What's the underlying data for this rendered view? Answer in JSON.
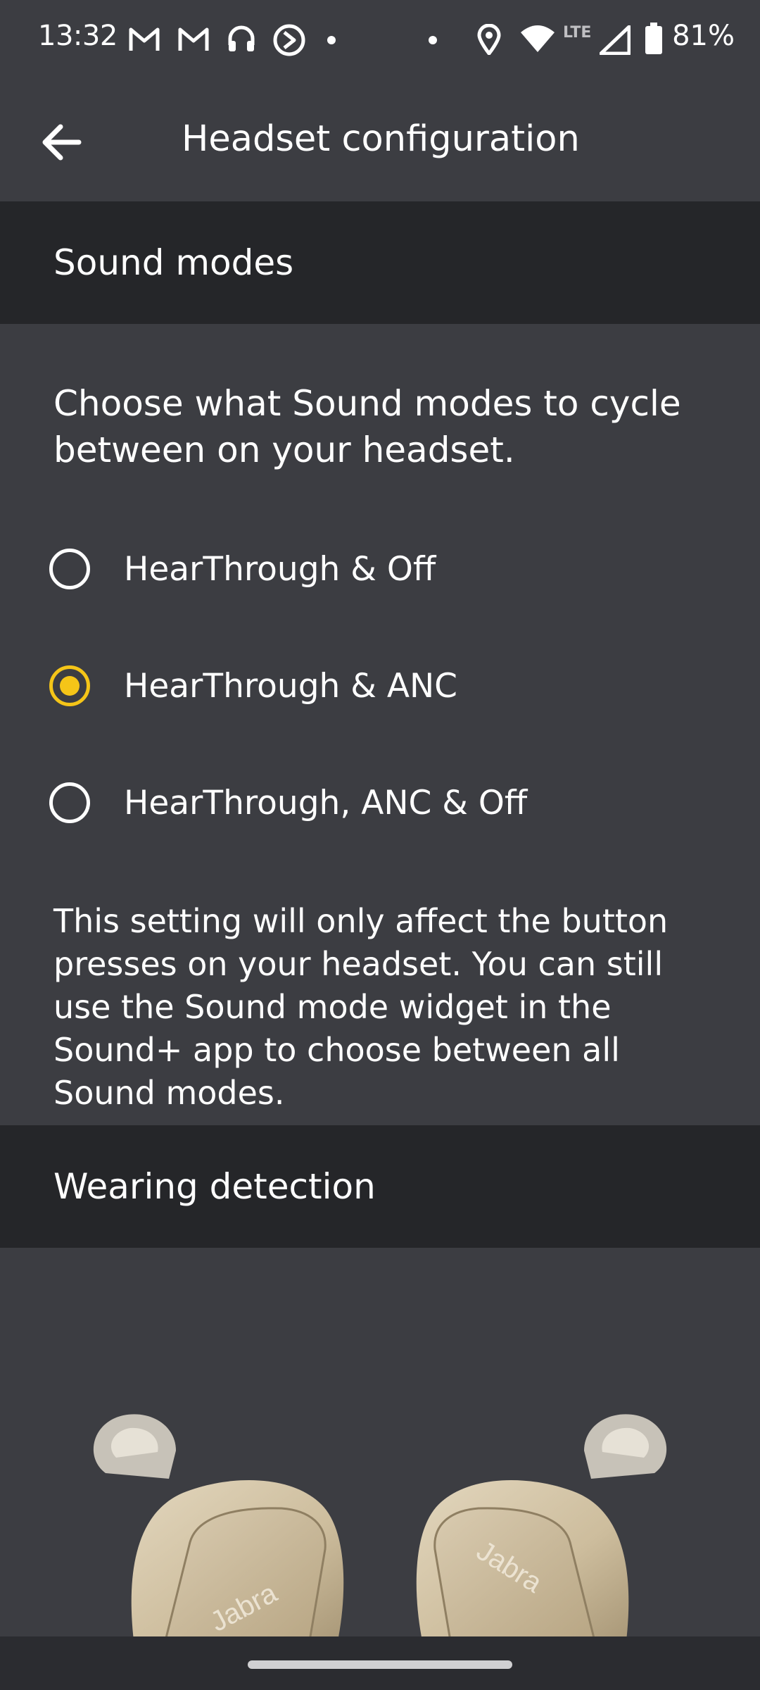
{
  "status_bar": {
    "time": "13:32",
    "network_label": "LTE",
    "battery": "81%",
    "icons": [
      "gmail-icon",
      "gmail-icon",
      "headphones-icon",
      "sync-icon",
      "dot-icon",
      "dot-icon",
      "location-icon",
      "wifi-icon",
      "signal-icon",
      "battery-icon"
    ]
  },
  "header": {
    "back_icon": "arrow-back-icon",
    "title": "Headset configuration"
  },
  "sound_modes": {
    "section_title": "Sound modes",
    "intro": "Choose what Sound modes to cycle between on your headset.",
    "options": [
      {
        "label": "HearThrough & Off",
        "selected": false
      },
      {
        "label": "HearThrough & ANC",
        "selected": true
      },
      {
        "label": "HearThrough, ANC & Off",
        "selected": false
      }
    ],
    "note": "This setting will only affect the button presses on your headset. You can still use the Sound mode widget in the Sound+ app to choose between all Sound modes."
  },
  "wearing_detection": {
    "section_title": "Wearing detection",
    "image_brand_text": "Jabra"
  },
  "colors": {
    "background": "#3c3d42",
    "section_header": "#252629",
    "accent": "#f5c518",
    "text": "#ffffff"
  }
}
